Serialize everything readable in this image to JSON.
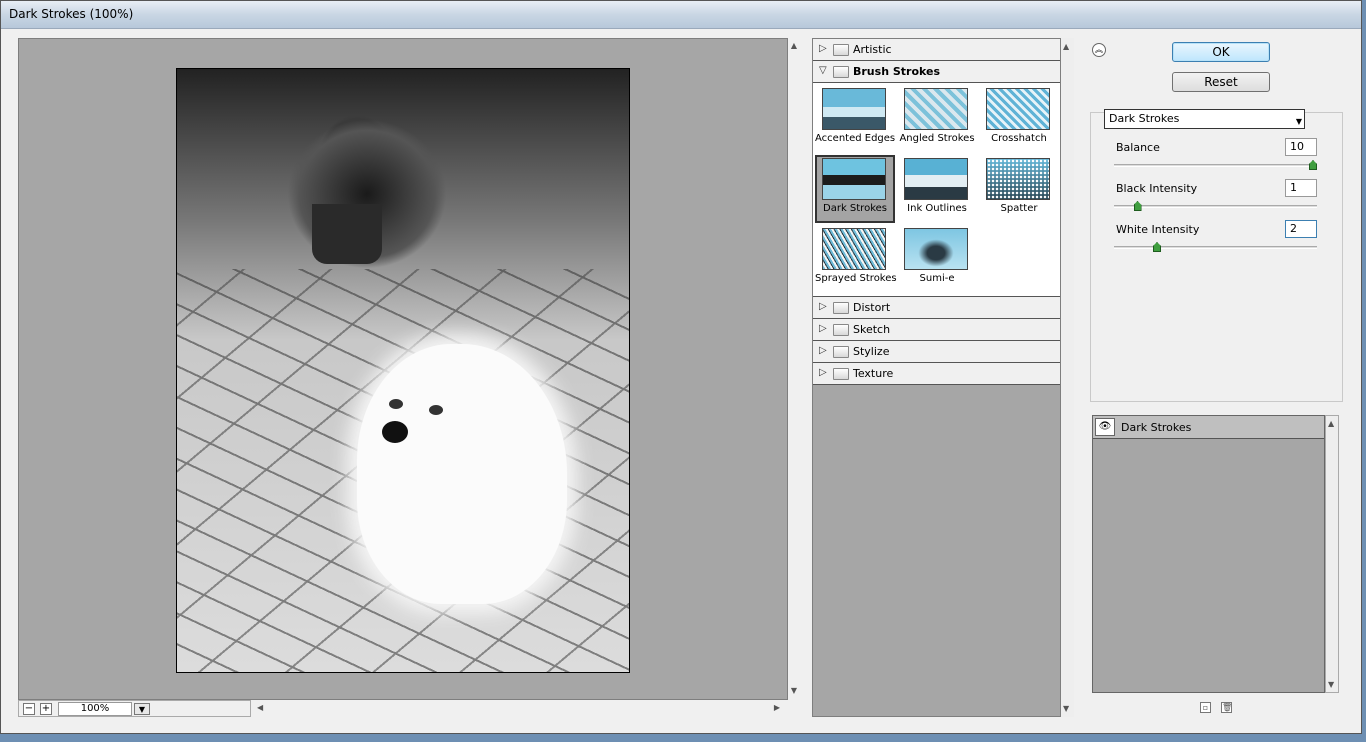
{
  "window": {
    "title": "Dark Strokes (100%)"
  },
  "preview": {
    "zoom": "100%"
  },
  "gallery": {
    "categories": [
      {
        "label": "Artistic",
        "open": false
      },
      {
        "label": "Brush Strokes",
        "open": true
      },
      {
        "label": "Distort",
        "open": false
      },
      {
        "label": "Sketch",
        "open": false
      },
      {
        "label": "Stylize",
        "open": false
      },
      {
        "label": "Texture",
        "open": false
      }
    ],
    "thumbnails": [
      {
        "label": "Accented Edges",
        "selected": false
      },
      {
        "label": "Angled Strokes",
        "selected": false
      },
      {
        "label": "Crosshatch",
        "selected": false
      },
      {
        "label": "Dark Strokes",
        "selected": true
      },
      {
        "label": "Ink Outlines",
        "selected": false
      },
      {
        "label": "Spatter",
        "selected": false
      },
      {
        "label": "Sprayed Strokes",
        "selected": false
      },
      {
        "label": "Sumi-e",
        "selected": false
      }
    ]
  },
  "buttons": {
    "ok": "OK",
    "reset": "Reset"
  },
  "settings": {
    "filter": "Dark Strokes",
    "params": [
      {
        "label": "Balance",
        "value": "10",
        "level": 1.0
      },
      {
        "label": "Black Intensity",
        "value": "1",
        "level": 0.1
      },
      {
        "label": "White Intensity",
        "value": "2",
        "level": 0.2
      }
    ]
  },
  "layers": {
    "items": [
      {
        "name": "Dark Strokes",
        "visible": true
      }
    ]
  },
  "icons": {
    "collapse": "double-chevron-up-icon",
    "zoom_out": "minus-icon",
    "zoom_in": "plus-icon",
    "new_layer": "new-effect-layer-icon",
    "delete_layer": "trash-icon",
    "visibility": "eye-icon"
  },
  "colors": {
    "accent": "#3c7fb1",
    "slider": "#3f9e3f",
    "panel": "#a6a6a6"
  }
}
